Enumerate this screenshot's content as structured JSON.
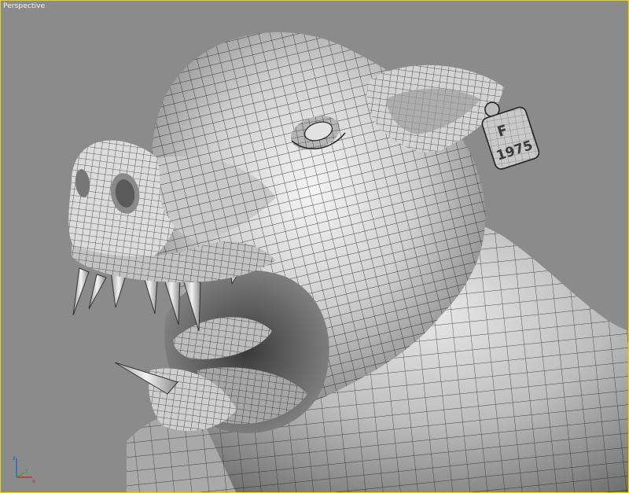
{
  "viewport": {
    "label": "Perspective",
    "border_color": "#f2d100",
    "background_color": "#8b8b8b"
  },
  "model": {
    "ear_tag_letter": "F",
    "ear_tag_number": "1975",
    "render_mode": "smooth shaded + wireframe edged faces"
  },
  "gizmo": {
    "x_label": "x",
    "y_label": "y",
    "z_label": "z",
    "x_color": "#d02020",
    "y_color": "#20b020",
    "z_color": "#2060d0"
  }
}
